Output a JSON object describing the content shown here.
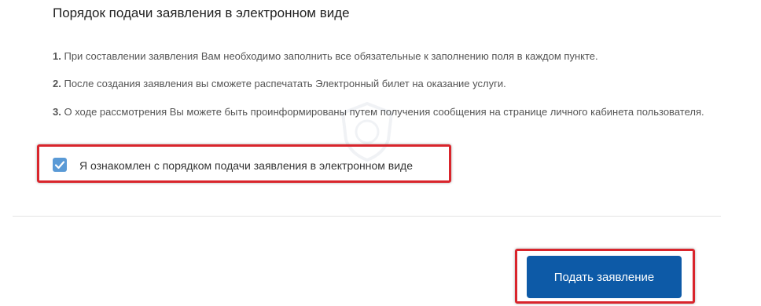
{
  "title": "Порядок подачи заявления в электронном виде",
  "steps": [
    {
      "num": "1.",
      "text": "При составлении заявления Вам необходимо заполнить все обязательные к заполнению поля в каждом пункте."
    },
    {
      "num": "2.",
      "text": "После создания заявления вы сможете распечатать Электронный билет на оказание услуги."
    },
    {
      "num": "3.",
      "text": "О ходе рассмотрения Вы можете быть проинформированы путем получения сообщения на странице личного кабинета пользователя."
    }
  ],
  "acknowledgement": {
    "label": "Я ознакомлен с порядком подачи заявления в электронном виде",
    "checked": true
  },
  "submit_button": {
    "label": "Подать заявление"
  },
  "colors": {
    "accent": "#0d5aa7",
    "checkbox": "#5a9ad6",
    "highlight": "#d9252c"
  },
  "icons": {
    "checkbox": "checkmark-icon",
    "watermark": "emblem-watermark-icon"
  }
}
